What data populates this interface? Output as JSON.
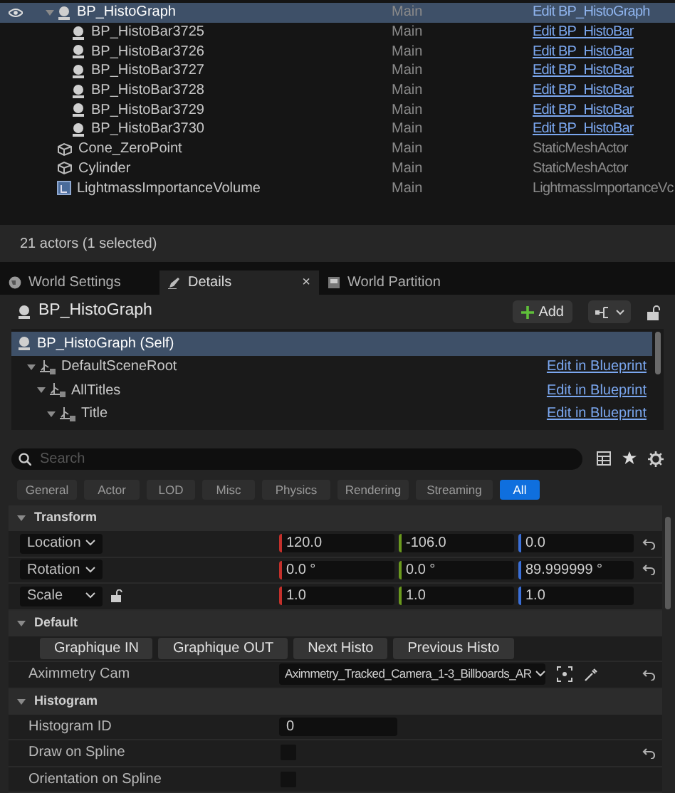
{
  "outliner": {
    "rows": [
      {
        "name": "BP_HistoGraph",
        "layer": "Main",
        "type": "Edit BP_HistoGraph",
        "kind": "blueprint",
        "selected": true,
        "expanded": true,
        "children": [
          {
            "name": "BP_HistoBar3725",
            "layer": "Main",
            "type": "Edit BP_HistoBar",
            "kind": "blueprint",
            "selected": false
          },
          {
            "name": "BP_HistoBar3726",
            "layer": "Main",
            "type": "Edit BP_HistoBar",
            "kind": "blueprint",
            "selected": false
          },
          {
            "name": "BP_HistoBar3727",
            "layer": "Main",
            "type": "Edit BP_HistoBar",
            "kind": "blueprint",
            "selected": false
          },
          {
            "name": "BP_HistoBar3728",
            "layer": "Main",
            "type": "Edit BP_HistoBar",
            "kind": "blueprint",
            "selected": false
          },
          {
            "name": "BP_HistoBar3729",
            "layer": "Main",
            "type": "Edit BP_HistoBar",
            "kind": "blueprint",
            "selected": false
          },
          {
            "name": "BP_HistoBar3730",
            "layer": "Main",
            "type": "Edit BP_HistoBar",
            "kind": "blueprint",
            "selected": false
          }
        ]
      },
      {
        "name": "Cone_ZeroPoint",
        "layer": "Main",
        "type": "StaticMeshActor",
        "kind": "mesh",
        "selected": false
      },
      {
        "name": "Cylinder",
        "layer": "Main",
        "type": "StaticMeshActor",
        "kind": "mesh",
        "selected": false
      },
      {
        "name": "LightmassImportanceVolume",
        "layer": "Main",
        "type": "LightmassImportanceVc",
        "kind": "volume",
        "selected": false
      }
    ],
    "status": "21 actors (1 selected)"
  },
  "tabs": [
    {
      "label": "World Settings",
      "kind": "globe",
      "selected": false
    },
    {
      "label": "Details",
      "kind": "pencil",
      "selected": true,
      "close": "×"
    },
    {
      "label": "World Partition",
      "kind": "map",
      "selected": false
    }
  ],
  "details": {
    "title": "BP_HistoGraph",
    "add_button": "Add",
    "components": [
      {
        "name": "BP_HistoGraph (Self)",
        "selected": true,
        "children": [
          {
            "name": "DefaultSceneRoot",
            "selected": false,
            "link": "Edit in Blueprint",
            "expanded": true,
            "children": [
              {
                "name": "AllTitles",
                "selected": false,
                "link": "Edit in Blueprint",
                "expanded": true,
                "children": [
                  {
                    "name": "Title",
                    "selected": false,
                    "link": "Edit in Blueprint",
                    "expanded": true
                  }
                ]
              }
            ]
          }
        ]
      }
    ],
    "search": {
      "placeholder": "Search"
    },
    "filters": [
      {
        "label": "General",
        "selected": false
      },
      {
        "label": "Actor",
        "selected": false
      },
      {
        "label": "LOD",
        "selected": false
      },
      {
        "label": "Misc",
        "selected": false
      },
      {
        "label": "Physics",
        "selected": false
      },
      {
        "label": "Rendering",
        "selected": false
      },
      {
        "label": "Streaming",
        "selected": false
      },
      {
        "label": "All",
        "selected": true
      }
    ],
    "sections": [
      {
        "title": "Transform",
        "expanded": true,
        "rows": [
          {
            "kind": "vector",
            "label": "Location",
            "values": [
              "120.0",
              "-106.0",
              "0.0"
            ],
            "reset": true,
            "lock": false
          },
          {
            "kind": "vector",
            "label": "Rotation",
            "values": [
              "0.0 °",
              "0.0 °",
              "89.999999 °"
            ],
            "reset": true,
            "lock": false
          },
          {
            "kind": "vector",
            "label": "Scale",
            "values": [
              "1.0",
              "1.0",
              "1.0"
            ],
            "reset": false,
            "lock": true
          }
        ]
      },
      {
        "title": "Default",
        "expanded": true,
        "rows": [
          {
            "kind": "buttons",
            "buttons": [
              "Graphique IN",
              "Graphique OUT",
              "Next Histo",
              "Previous Histo"
            ]
          },
          {
            "kind": "object",
            "label": "Aximmetry Cam",
            "value": "Aximmetry_Tracked_Camera_1-3_Billboards_AR",
            "reset": true
          }
        ]
      },
      {
        "title": "Histogram",
        "expanded": true,
        "rows": [
          {
            "kind": "number",
            "label": "Histogram ID",
            "value": "0",
            "reset": false
          },
          {
            "kind": "checkbox",
            "label": "Draw on Spline",
            "checked": false,
            "reset": true
          },
          {
            "kind": "checkbox",
            "label": "Orientation on Spline",
            "checked": false,
            "reset": false
          }
        ]
      }
    ]
  }
}
